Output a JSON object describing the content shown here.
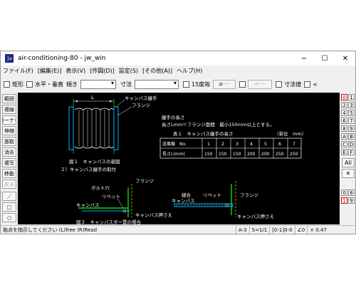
{
  "window": {
    "title": "air-conditioning-80 - jw_win",
    "icon": "jw",
    "minimize": "−",
    "maximize": "☐",
    "close": "✕"
  },
  "menu": [
    "ファイル(F)",
    "[編集(E)]",
    "表示(V)",
    "[作図(D)]",
    "設定(S)",
    "[その他(A)]",
    "ヘルプ(H)"
  ],
  "toolbar": {
    "rect": "矩形",
    "hv": "水平・垂直",
    "angle": "傾き",
    "dim": "寸法",
    "deg15": "15度毎",
    "btn1": "●----",
    "btn2": "<----",
    "dimval": "寸法値",
    "lt": "<"
  },
  "left_tools": [
    {
      "label": "範囲",
      "enabled": true
    },
    {
      "label": "複線",
      "enabled": true
    },
    {
      "label": "コーナー",
      "enabled": true
    },
    {
      "label": "伸縮",
      "enabled": true
    },
    {
      "label": "面取",
      "enabled": true
    },
    {
      "label": "消去",
      "enabled": true
    },
    {
      "label": "複写",
      "enabled": true
    },
    {
      "label": "移動",
      "enabled": true
    },
    {
      "label": "戻る",
      "enabled": false
    },
    {
      "label": "／",
      "enabled": true
    },
    {
      "label": "□",
      "enabled": true
    },
    {
      "label": "○",
      "enabled": true
    }
  ],
  "layer_numbers": {
    "left": [
      "0",
      "2",
      "4",
      "6",
      "8",
      "A",
      "C",
      "E"
    ],
    "right": [
      "1",
      "3",
      "5",
      "7",
      "9",
      "B",
      "D",
      "F"
    ]
  },
  "layer_extra": {
    "all": "All",
    "x": "✕",
    "grp_left": [
      "0",
      "1"
    ],
    "grp_right": [
      "8",
      "9"
    ]
  },
  "drawing": {
    "fig1_caption": "図１　キャンバスの姿図",
    "fig2_caption": "２）キャンバス継手の取付",
    "label_canvas_joint": "キャンバス継手",
    "label_flange": "フランジ",
    "dim_L": "L",
    "note_title": "継手の長さ",
    "note_body": "長さLmm＝フランジ面間　最小150ｍｍ以上とする。",
    "table_title": "表１　キャンバス継手の長さ",
    "table_unit": "（単位　mm）",
    "table_header": [
      "送風機　No.",
      "1",
      "2",
      "3",
      "4",
      "5",
      "6",
      "7"
    ],
    "table_row": [
      "長さL(mm)",
      "150",
      "150",
      "150",
      "200",
      "200",
      "250",
      "250"
    ],
    "label_bolt_hole": "ボルト穴",
    "label_rivet": "リベット",
    "label_canvas": "キャンバス",
    "label_presser": "キャンバス押さえ",
    "label_seam": "縫合",
    "label_rivet2": "リベット",
    "label_flange2": "フランジ",
    "label_canvas2": "キャンバス",
    "label_presser2": "キャンバス押さえ",
    "fig2_caption_partial": "図２　キャンバスダー置の場合"
  },
  "status": {
    "message": "始点を指示してください (L)free (R)Read",
    "paper": "A-3",
    "scale": "S=1/1",
    "layer": "[0-1]0-0",
    "angle": "∠0",
    "zoom": "× 0.47"
  }
}
